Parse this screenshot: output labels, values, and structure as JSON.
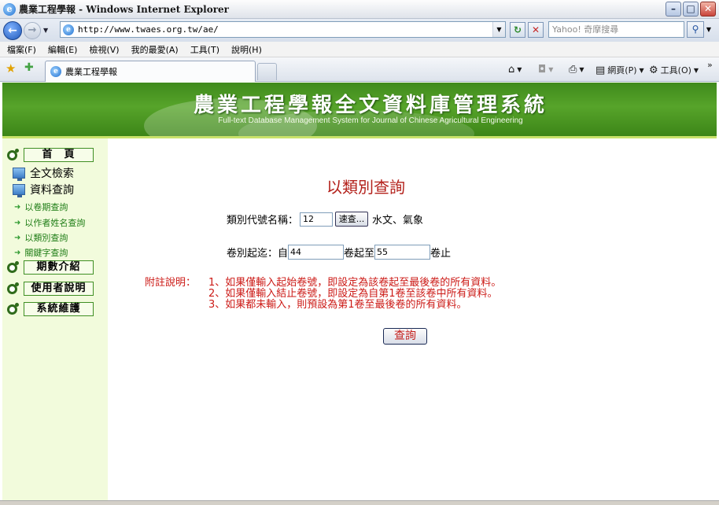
{
  "window": {
    "title": "農業工程學報 - Windows Internet Explorer"
  },
  "address_bar": {
    "url": "http://www.twaes.org.tw/ae/",
    "search_placeholder": "Yahoo! 奇摩搜尋"
  },
  "menu": [
    "檔案(F)",
    "編輯(E)",
    "檢視(V)",
    "我的最愛(A)",
    "工具(T)",
    "說明(H)"
  ],
  "tab": {
    "label": "農業工程學報"
  },
  "commands": {
    "page": "網頁(P)",
    "tools": "工具(O)"
  },
  "banner": {
    "title": "農業工程學報全文資料庫管理系統",
    "subtitle": "Full-text Database Management System for Journal of Chinese Agricultural Engineering"
  },
  "sidebar": {
    "home": "首　頁",
    "fulltext": "全文檢索",
    "data_query": "資料查詢",
    "links": [
      "以卷期查詢",
      "以作者姓名查詢",
      "以類別查詢",
      "關鍵字查詢"
    ],
    "issues": "期數介紹",
    "manual": "使用者說明",
    "maintenance": "系統維護"
  },
  "main": {
    "title": "以類別查詢",
    "category_label": "類別代號名稱：",
    "category_code": "12",
    "browse_button": "速查...",
    "category_name": "水文、氣象",
    "volume_label": "卷別起迄：自",
    "volume_from": "44",
    "volume_mid": "卷起至",
    "volume_to": "55",
    "volume_end": "卷止",
    "notes_label": "附註說明：",
    "notes": [
      "1、如果僅輸入起始卷號，即設定為該卷起至最後卷的所有資料。",
      "2、如果僅輸入結止卷號，即設定為自第1卷至該卷中所有資料。",
      "3、如果都未輸入，則預設為第1卷至最後卷的所有資料。"
    ],
    "query_button": "查詢"
  }
}
